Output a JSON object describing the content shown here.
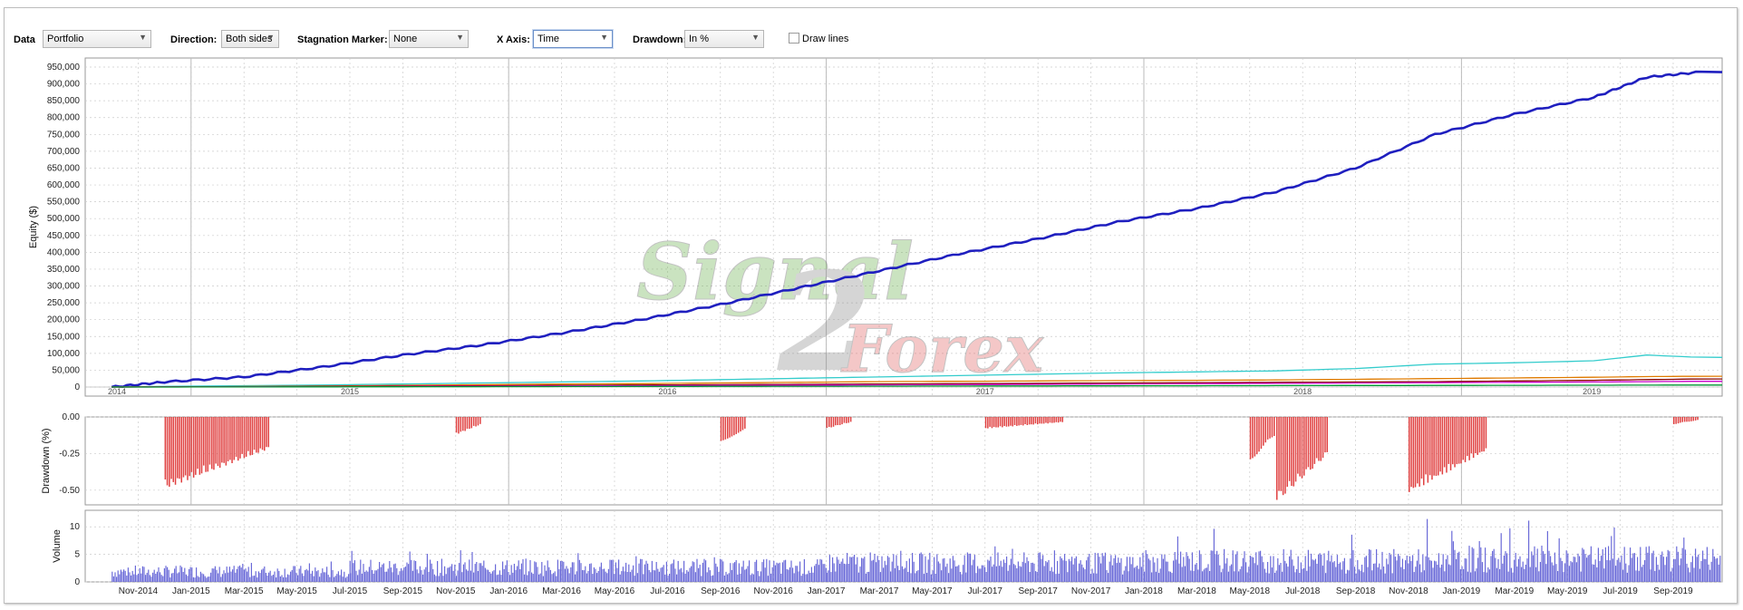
{
  "toolbar": {
    "data_label": "Data",
    "data_value": "Portfolio",
    "direction_label": "Direction:",
    "direction_value": "Both sides",
    "stagnation_label": "Stagnation Marker:",
    "stagnation_value": "None",
    "xaxis_label": "X Axis:",
    "xaxis_value": "Time",
    "drawdown_label": "Drawdown:",
    "drawdown_value": "In %",
    "draw_lines_label": "Draw lines",
    "draw_lines_checked": false
  },
  "watermark": "Signal2Forex",
  "colors": {
    "equity_main": "#1f1fbf",
    "drawdown": "#e04040",
    "volume": "#6a6ad8",
    "grid": "#cccccc",
    "year_line": "#bbbbbb"
  },
  "chart_data": [
    {
      "type": "line",
      "ylabel": "Equity ($)",
      "ylim": [
        0,
        950000
      ],
      "yticks": [
        "0",
        "50,000",
        "100,000",
        "150,000",
        "200,000",
        "250,000",
        "300,000",
        "350,000",
        "400,000",
        "450,000",
        "500,000",
        "550,000",
        "600,000",
        "650,000",
        "700,000",
        "750,000",
        "800,000",
        "850,000",
        "900,000",
        "950,000"
      ],
      "year_labels": [
        "2014",
        "2015",
        "2016",
        "2017",
        "2018",
        "2019"
      ],
      "x": [
        "2014-10",
        "2014-12",
        "2015-03",
        "2015-06",
        "2015-09",
        "2015-12",
        "2016-03",
        "2016-06",
        "2016-09",
        "2016-12",
        "2017-03",
        "2017-06",
        "2017-09",
        "2017-12",
        "2018-03",
        "2018-06",
        "2018-09",
        "2018-12",
        "2019-03",
        "2019-06",
        "2019-08",
        "2019-10"
      ],
      "series": [
        {
          "color": "#1f1fbf",
          "values": [
            0,
            15000,
            30000,
            60000,
            95000,
            125000,
            160000,
            200000,
            245000,
            295000,
            345000,
            395000,
            440000,
            490000,
            530000,
            580000,
            650000,
            750000,
            810000,
            860000,
            920000,
            935000
          ]
        },
        {
          "color": "#33cccc",
          "values": [
            0,
            2000,
            4000,
            6000,
            9000,
            12000,
            15000,
            18000,
            22000,
            26000,
            30000,
            34000,
            38000,
            42000,
            45000,
            48000,
            55000,
            68000,
            72000,
            78000,
            95000,
            88000
          ]
        },
        {
          "color": "#e07b00",
          "values": [
            0,
            500,
            1500,
            3000,
            5000,
            7000,
            9000,
            10000,
            12000,
            14000,
            16000,
            17000,
            18000,
            19000,
            20000,
            21000,
            23000,
            25000,
            27000,
            29000,
            31000,
            32000
          ]
        },
        {
          "color": "#8b0000",
          "values": [
            0,
            300,
            1000,
            2000,
            3000,
            4000,
            5000,
            6000,
            7000,
            8000,
            9000,
            10000,
            11000,
            12000,
            13000,
            14000,
            15000,
            16000,
            18000,
            20000,
            22000,
            24000
          ]
        },
        {
          "color": "#cc00cc",
          "values": [
            0,
            200,
            600,
            1200,
            1800,
            2500,
            3200,
            4000,
            4800,
            5600,
            6400,
            7200,
            8000,
            9000,
            10000,
            11000,
            12000,
            13000,
            14000,
            15000,
            16000,
            17000
          ]
        },
        {
          "color": "#009933",
          "values": [
            0,
            100,
            300,
            600,
            900,
            1200,
            1500,
            1800,
            2100,
            2400,
            2700,
            3000,
            3300,
            3600,
            3900,
            4200,
            4500,
            4800,
            5100,
            5400,
            5700,
            6000
          ]
        }
      ]
    },
    {
      "type": "bar",
      "ylabel": "Drawdown (%)",
      "ylim": [
        -0.6,
        0
      ],
      "yticks": [
        "0.00",
        "-0.25",
        "-0.50"
      ],
      "events": [
        {
          "start": "2014-12",
          "end": "2015-03",
          "depth": -0.49
        },
        {
          "start": "2015-11",
          "end": "2015-11",
          "depth": -0.12
        },
        {
          "start": "2016-09",
          "end": "2016-09",
          "depth": -0.18
        },
        {
          "start": "2017-01",
          "end": "2017-01",
          "depth": -0.08
        },
        {
          "start": "2017-07",
          "end": "2017-09",
          "depth": -0.08
        },
        {
          "start": "2018-05",
          "end": "2018-05",
          "depth": -0.3
        },
        {
          "start": "2018-06",
          "end": "2018-07",
          "depth": -0.58
        },
        {
          "start": "2018-11",
          "end": "2019-01",
          "depth": -0.52
        },
        {
          "start": "2019-09",
          "end": "2019-09",
          "depth": -0.05
        }
      ]
    },
    {
      "type": "bar",
      "ylabel": "Volume",
      "ylim": [
        0,
        13
      ],
      "yticks": [
        "0",
        "5",
        "10"
      ],
      "month_labels": [
        "Nov-2014",
        "Jan-2015",
        "Mar-2015",
        "May-2015",
        "Jul-2015",
        "Sep-2015",
        "Nov-2015",
        "Jan-2016",
        "Mar-2016",
        "May-2016",
        "Jul-2016",
        "Sep-2016",
        "Nov-2016",
        "Jan-2017",
        "Mar-2017",
        "May-2017",
        "Jul-2017",
        "Sep-2017",
        "Nov-2017",
        "Jan-2018",
        "Mar-2018",
        "May-2018",
        "Jul-2018",
        "Sep-2018",
        "Nov-2018",
        "Jan-2019",
        "Mar-2019",
        "May-2019",
        "Jul-2019",
        "Sep-2019"
      ],
      "level_by_period": [
        {
          "from": "2014-10",
          "to": "2015-06",
          "typical": 2.5,
          "max": 4
        },
        {
          "from": "2015-07",
          "to": "2016-12",
          "typical": 3.5,
          "max": 6
        },
        {
          "from": "2017-01",
          "to": "2017-12",
          "typical": 4.5,
          "max": 7
        },
        {
          "from": "2018-01",
          "to": "2018-12",
          "typical": 5,
          "max": 12
        },
        {
          "from": "2019-01",
          "to": "2019-10",
          "typical": 5.5,
          "max": 12
        }
      ]
    }
  ]
}
